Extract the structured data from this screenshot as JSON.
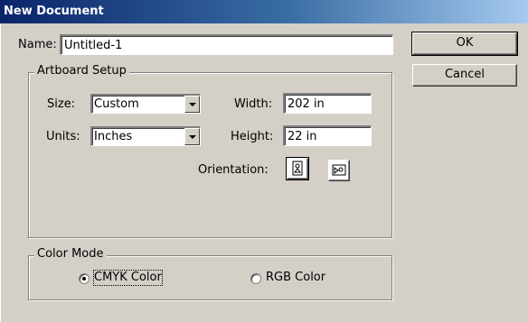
{
  "window": {
    "title": "New Document"
  },
  "name_field": {
    "label": "Name:",
    "value": "Untitled-1"
  },
  "buttons": {
    "ok": "OK",
    "cancel": "Cancel"
  },
  "artboard": {
    "title": "Artboard Setup",
    "size_label": "Size:",
    "size_value": "Custom",
    "units_label": "Units:",
    "units_value": "Inches",
    "width_label": "Width:",
    "width_value": "202 in",
    "height_label": "Height:",
    "height_value": "22 in",
    "orientation_label": "Orientation:"
  },
  "color_mode": {
    "title": "Color Mode",
    "options": [
      {
        "label": "CMYK Color",
        "selected": true
      },
      {
        "label": "RGB Color",
        "selected": false
      }
    ]
  }
}
